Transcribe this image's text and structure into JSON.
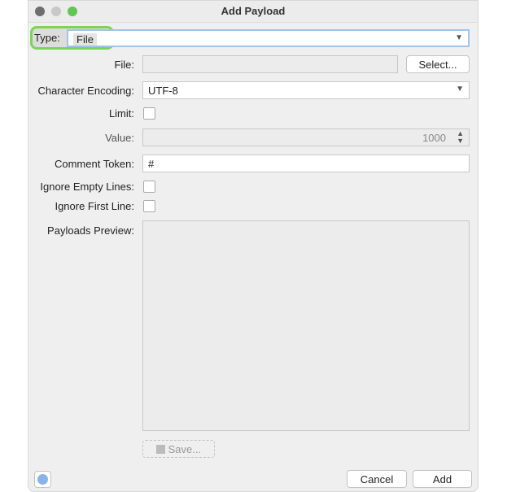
{
  "window": {
    "title": "Add Payload"
  },
  "form": {
    "type_label": "Type:",
    "type_value": "File",
    "file_label": "File:",
    "file_value": "",
    "select_button": "Select...",
    "encoding_label": "Character Encoding:",
    "encoding_value": "UTF-8",
    "limit_label": "Limit:",
    "value_label": "Value:",
    "value_value": "1000",
    "comment_label": "Comment Token:",
    "comment_value": "#",
    "ignore_empty_label": "Ignore Empty Lines:",
    "ignore_first_label": "Ignore First Line:",
    "preview_label": "Payloads Preview:",
    "save_button": "Save..."
  },
  "footer": {
    "cancel": "Cancel",
    "add": "Add"
  },
  "colors": {
    "highlight": "#7bd45a",
    "focus": "#a3c3eb"
  }
}
